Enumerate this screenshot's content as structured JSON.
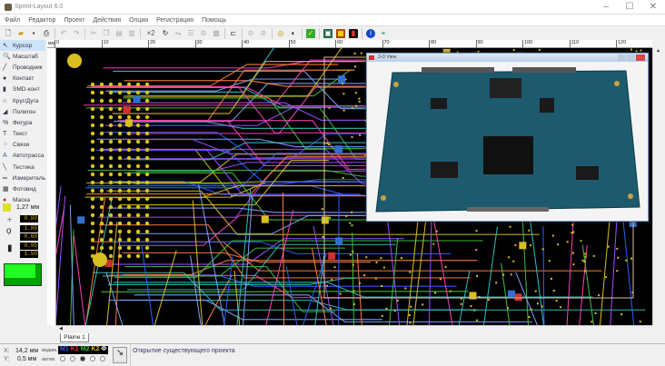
{
  "window": {
    "title": "Sprint-Layout 6.0",
    "minimize": "–",
    "maximize": "☐",
    "close": "✕"
  },
  "menu": [
    "Файл",
    "Редактор",
    "Проект",
    "Действия",
    "Опции",
    "Регистрация",
    "Помощь"
  ],
  "toolbar": {
    "zoom_label": "×2"
  },
  "tools": [
    {
      "label": "Курсор",
      "icon": "cursor-icon",
      "glyph": "↖"
    },
    {
      "label": "Масштаб",
      "icon": "zoom-icon",
      "glyph": "🔍"
    },
    {
      "label": "Проводник",
      "icon": "track-icon",
      "glyph": "╱"
    },
    {
      "label": "Контакт",
      "icon": "pad-icon",
      "glyph": "●"
    },
    {
      "label": "SMD-конт",
      "icon": "smd-pad-icon",
      "glyph": "▮"
    },
    {
      "label": "Круг/Дуга",
      "icon": "circle-icon",
      "glyph": "○"
    },
    {
      "label": "Полигон",
      "icon": "polygon-icon",
      "glyph": "◢"
    },
    {
      "label": "Фигура",
      "icon": "shape-icon",
      "glyph": "%"
    },
    {
      "label": "Текст",
      "icon": "text-icon",
      "glyph": "T"
    },
    {
      "label": "Связи",
      "icon": "connections-icon",
      "glyph": "⁘"
    },
    {
      "label": "Автотрасса",
      "icon": "autoroute-icon",
      "glyph": "A"
    },
    {
      "label": "Тестика",
      "icon": "test-icon",
      "glyph": "╲"
    },
    {
      "label": "Измеритель",
      "icon": "measure-icon",
      "glyph": "═"
    },
    {
      "label": "Фотовид",
      "icon": "photoview-icon",
      "glyph": "▦"
    },
    {
      "label": "Маска",
      "icon": "mask-icon",
      "glyph": "●"
    }
  ],
  "grid": "1,27 мм",
  "params": {
    "track_width": "0.80",
    "pad_outer": "1.80",
    "pad_inner": "0.60",
    "smd_w": "0.90",
    "smd_h": "1.50"
  },
  "ruler_ticks": [
    "0",
    "10",
    "20",
    "30",
    "40",
    "50",
    "60",
    "70",
    "80",
    "90",
    "100",
    "110",
    "120"
  ],
  "ruler_unit": "мм",
  "tab": "Plaine 1",
  "view3d": {
    "title": "3-D View"
  },
  "status": {
    "x_label": "X:",
    "x": "14,2 мм",
    "y_label": "Y:",
    "y": "0,5 мм",
    "visible_label": "видим.",
    "active_label": "актив.",
    "layers": [
      "M1",
      "K1",
      "M2",
      "K2",
      "Ф"
    ],
    "help": "?",
    "message": "Открытие существующего проекта"
  },
  "colors": {
    "M1": "#3060ff",
    "K1": "#ff3030",
    "M2": "#30c030",
    "K2": "#e0c000",
    "Ф": "#ffffff"
  }
}
